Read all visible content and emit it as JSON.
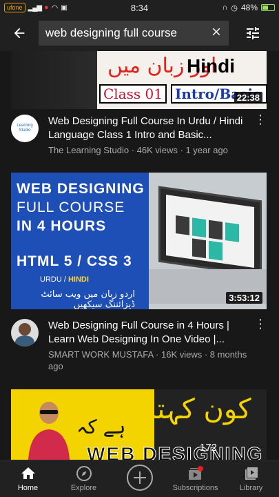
{
  "status_bar": {
    "carrier": "ufone",
    "time": "8:34",
    "battery": "48%",
    "battery_level": 0.48
  },
  "header": {
    "query": "web designing full course",
    "icons": [
      "arrow-left-icon",
      "close-icon",
      "filter-icon"
    ]
  },
  "videos": [
    {
      "thumb": {
        "urdu": "اور زبان میں",
        "hindi": "Hindi",
        "class": "Class 01",
        "intro": "Intro/Basic"
      },
      "duration": "22:38",
      "title": "Web Designing Full Course In Urdu / Hindi Language Class 1 Intro and Basic...",
      "channel": "The Learning Studio",
      "views": "46K views",
      "age": "1 year ago",
      "avatar_text": "Learning Studio"
    },
    {
      "thumb": {
        "line1": "WEB DESIGNING",
        "line2": "FULL COURSE",
        "line3": "IN 4 HOURS",
        "line4": "HTML 5 / CSS 3",
        "line5a": "URDU / ",
        "line5b": "HINDI",
        "line6": "اردو زبان میں ویب سائٹ ڈیزائننگ سیکھیں"
      },
      "duration": "3:53:12",
      "title": "Web Designing Full Course in 4 Hours | Learn Web Designing In One Video |...",
      "channel": "SMART WORK MUSTAFA",
      "views": "16K views",
      "age": "8 months ago"
    },
    {
      "thumb": {
        "urdu": "کون کہتا",
        "urdu2": "ہے کہ",
        "web": "WEB DESIGNING"
      },
      "count": "172"
    }
  ],
  "nav": {
    "items": [
      {
        "label": "Home",
        "icon": "home-icon",
        "active": true
      },
      {
        "label": "Explore",
        "icon": "compass-icon",
        "active": false
      },
      {
        "label": "",
        "icon": "create-icon",
        "active": false
      },
      {
        "label": "Subscriptions",
        "icon": "subscriptions-icon",
        "active": false
      },
      {
        "label": "Library",
        "icon": "library-icon",
        "active": false
      }
    ]
  }
}
